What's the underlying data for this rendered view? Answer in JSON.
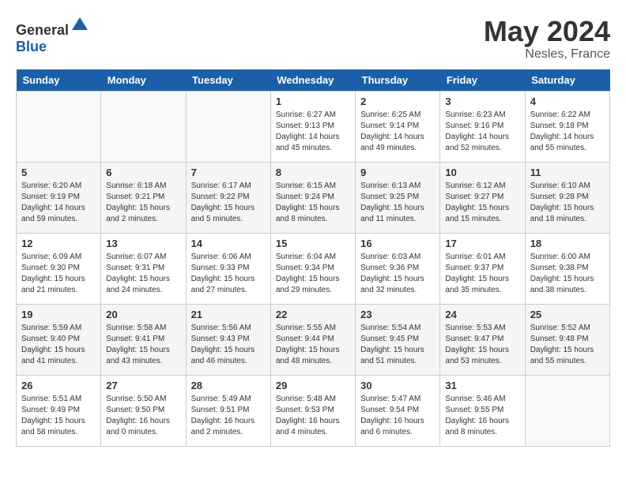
{
  "header": {
    "logo_general": "General",
    "logo_blue": "Blue",
    "month": "May 2024",
    "location": "Nesles, France"
  },
  "weekdays": [
    "Sunday",
    "Monday",
    "Tuesday",
    "Wednesday",
    "Thursday",
    "Friday",
    "Saturday"
  ],
  "weeks": [
    [
      {
        "day": "",
        "content": ""
      },
      {
        "day": "",
        "content": ""
      },
      {
        "day": "",
        "content": ""
      },
      {
        "day": "1",
        "content": "Sunrise: 6:27 AM\nSunset: 9:13 PM\nDaylight: 14 hours\nand 45 minutes."
      },
      {
        "day": "2",
        "content": "Sunrise: 6:25 AM\nSunset: 9:14 PM\nDaylight: 14 hours\nand 49 minutes."
      },
      {
        "day": "3",
        "content": "Sunrise: 6:23 AM\nSunset: 9:16 PM\nDaylight: 14 hours\nand 52 minutes."
      },
      {
        "day": "4",
        "content": "Sunrise: 6:22 AM\nSunset: 9:18 PM\nDaylight: 14 hours\nand 55 minutes."
      }
    ],
    [
      {
        "day": "5",
        "content": "Sunrise: 6:20 AM\nSunset: 9:19 PM\nDaylight: 14 hours\nand 59 minutes."
      },
      {
        "day": "6",
        "content": "Sunrise: 6:18 AM\nSunset: 9:21 PM\nDaylight: 15 hours\nand 2 minutes."
      },
      {
        "day": "7",
        "content": "Sunrise: 6:17 AM\nSunset: 9:22 PM\nDaylight: 15 hours\nand 5 minutes."
      },
      {
        "day": "8",
        "content": "Sunrise: 6:15 AM\nSunset: 9:24 PM\nDaylight: 15 hours\nand 8 minutes."
      },
      {
        "day": "9",
        "content": "Sunrise: 6:13 AM\nSunset: 9:25 PM\nDaylight: 15 hours\nand 11 minutes."
      },
      {
        "day": "10",
        "content": "Sunrise: 6:12 AM\nSunset: 9:27 PM\nDaylight: 15 hours\nand 15 minutes."
      },
      {
        "day": "11",
        "content": "Sunrise: 6:10 AM\nSunset: 9:28 PM\nDaylight: 15 hours\nand 18 minutes."
      }
    ],
    [
      {
        "day": "12",
        "content": "Sunrise: 6:09 AM\nSunset: 9:30 PM\nDaylight: 15 hours\nand 21 minutes."
      },
      {
        "day": "13",
        "content": "Sunrise: 6:07 AM\nSunset: 9:31 PM\nDaylight: 15 hours\nand 24 minutes."
      },
      {
        "day": "14",
        "content": "Sunrise: 6:06 AM\nSunset: 9:33 PM\nDaylight: 15 hours\nand 27 minutes."
      },
      {
        "day": "15",
        "content": "Sunrise: 6:04 AM\nSunset: 9:34 PM\nDaylight: 15 hours\nand 29 minutes."
      },
      {
        "day": "16",
        "content": "Sunrise: 6:03 AM\nSunset: 9:36 PM\nDaylight: 15 hours\nand 32 minutes."
      },
      {
        "day": "17",
        "content": "Sunrise: 6:01 AM\nSunset: 9:37 PM\nDaylight: 15 hours\nand 35 minutes."
      },
      {
        "day": "18",
        "content": "Sunrise: 6:00 AM\nSunset: 9:38 PM\nDaylight: 15 hours\nand 38 minutes."
      }
    ],
    [
      {
        "day": "19",
        "content": "Sunrise: 5:59 AM\nSunset: 9:40 PM\nDaylight: 15 hours\nand 41 minutes."
      },
      {
        "day": "20",
        "content": "Sunrise: 5:58 AM\nSunset: 9:41 PM\nDaylight: 15 hours\nand 43 minutes."
      },
      {
        "day": "21",
        "content": "Sunrise: 5:56 AM\nSunset: 9:43 PM\nDaylight: 15 hours\nand 46 minutes."
      },
      {
        "day": "22",
        "content": "Sunrise: 5:55 AM\nSunset: 9:44 PM\nDaylight: 15 hours\nand 48 minutes."
      },
      {
        "day": "23",
        "content": "Sunrise: 5:54 AM\nSunset: 9:45 PM\nDaylight: 15 hours\nand 51 minutes."
      },
      {
        "day": "24",
        "content": "Sunrise: 5:53 AM\nSunset: 9:47 PM\nDaylight: 15 hours\nand 53 minutes."
      },
      {
        "day": "25",
        "content": "Sunrise: 5:52 AM\nSunset: 9:48 PM\nDaylight: 15 hours\nand 55 minutes."
      }
    ],
    [
      {
        "day": "26",
        "content": "Sunrise: 5:51 AM\nSunset: 9:49 PM\nDaylight: 15 hours\nand 58 minutes."
      },
      {
        "day": "27",
        "content": "Sunrise: 5:50 AM\nSunset: 9:50 PM\nDaylight: 16 hours\nand 0 minutes."
      },
      {
        "day": "28",
        "content": "Sunrise: 5:49 AM\nSunset: 9:51 PM\nDaylight: 16 hours\nand 2 minutes."
      },
      {
        "day": "29",
        "content": "Sunrise: 5:48 AM\nSunset: 9:53 PM\nDaylight: 16 hours\nand 4 minutes."
      },
      {
        "day": "30",
        "content": "Sunrise: 5:47 AM\nSunset: 9:54 PM\nDaylight: 16 hours\nand 6 minutes."
      },
      {
        "day": "31",
        "content": "Sunrise: 5:46 AM\nSunset: 9:55 PM\nDaylight: 16 hours\nand 8 minutes."
      },
      {
        "day": "",
        "content": ""
      }
    ]
  ]
}
